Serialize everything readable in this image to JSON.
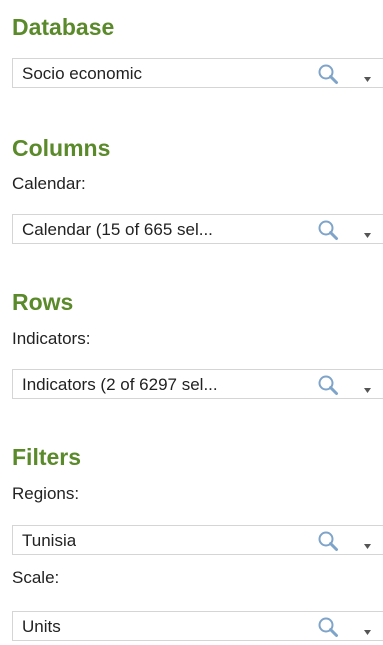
{
  "database": {
    "title": "Database",
    "select": {
      "value": "Socio economic"
    }
  },
  "columns": {
    "title": "Columns",
    "label": "Calendar:",
    "select": {
      "value": "Calendar (15 of 665 sel..."
    }
  },
  "rows": {
    "title": "Rows",
    "label": "Indicators:",
    "select": {
      "value": "Indicators (2 of 6297 sel..."
    }
  },
  "filters": {
    "title": "Filters",
    "regions": {
      "label": "Regions:",
      "select": {
        "value": "Tunisia"
      }
    },
    "scale": {
      "label": "Scale:",
      "select": {
        "value": "Units"
      }
    }
  },
  "icons": {
    "search": "search-icon",
    "dropdown": "chevron-down-icon"
  },
  "colors": {
    "section_title": "#5a8a2a",
    "text": "#222222",
    "border": "#d5d5d5",
    "search_icon": "#7fa4c9",
    "dropdown_icon": "#555555"
  }
}
